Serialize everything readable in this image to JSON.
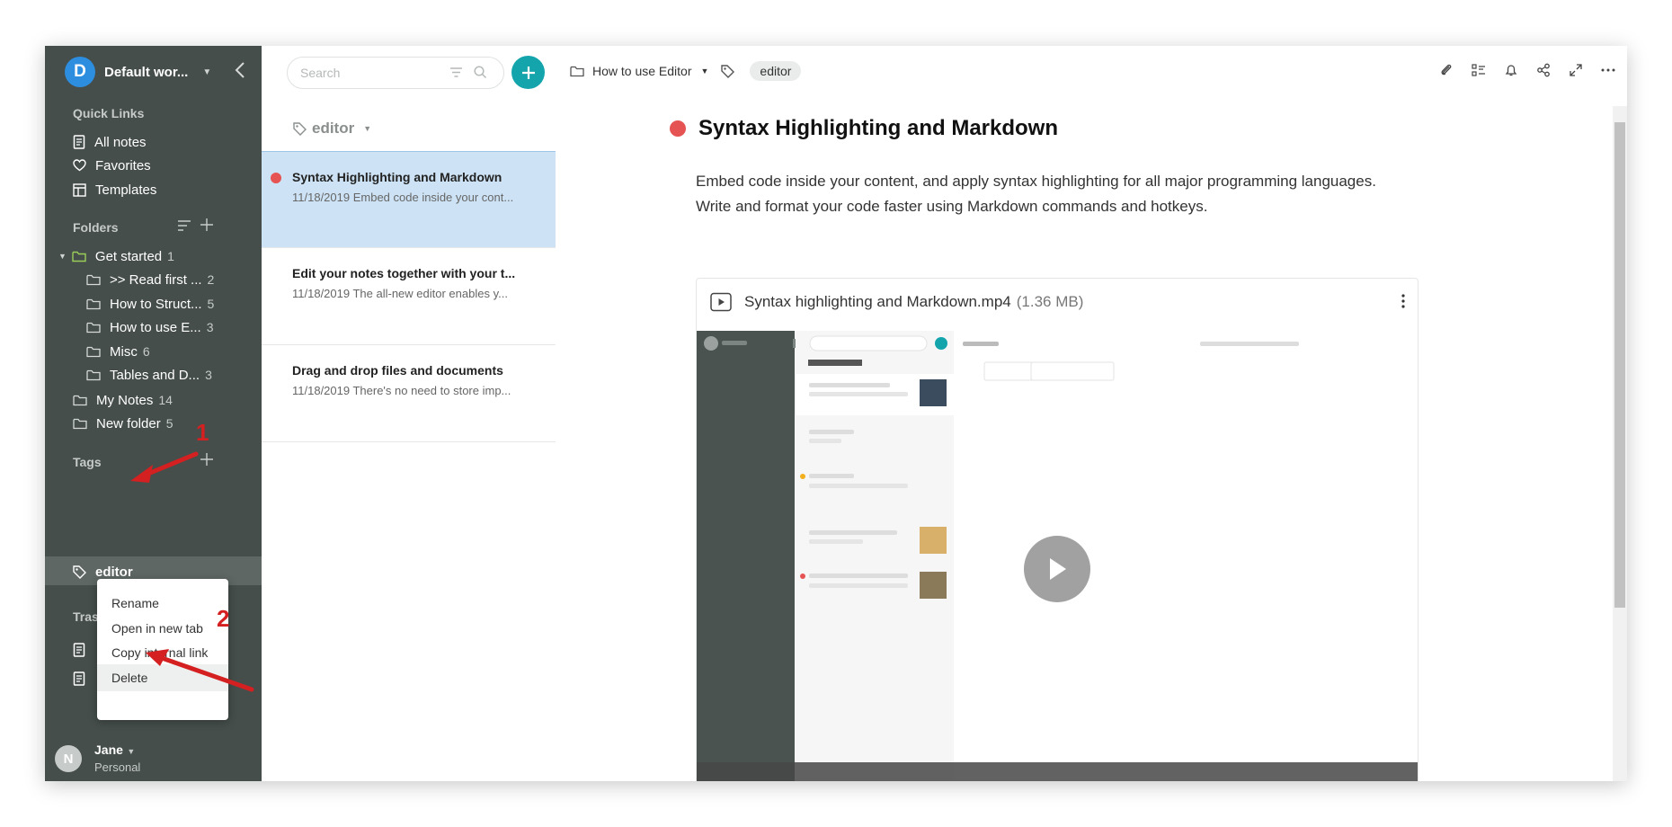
{
  "workspace": {
    "initial": "D",
    "name": "Default wor..."
  },
  "sidebar": {
    "quick_links_title": "Quick Links",
    "quick_links": [
      {
        "label": "All notes",
        "icon": "note-icon"
      },
      {
        "label": "Favorites",
        "icon": "heart-icon"
      },
      {
        "label": "Templates",
        "icon": "template-icon"
      }
    ],
    "folders_title": "Folders",
    "folders": [
      {
        "label": "Get started",
        "count": "1",
        "level": 0,
        "expanded": true
      },
      {
        "label": ">> Read first ...",
        "count": "2",
        "level": 1
      },
      {
        "label": "How to Struct...",
        "count": "5",
        "level": 1
      },
      {
        "label": "How to use E...",
        "count": "3",
        "level": 1
      },
      {
        "label": "Misc",
        "count": "6",
        "level": 1
      },
      {
        "label": "Tables and D...",
        "count": "3",
        "level": 1
      },
      {
        "label": "My Notes",
        "count": "14",
        "level": 0
      },
      {
        "label": "New folder",
        "count": "5",
        "level": 0
      }
    ],
    "tags_title": "Tags",
    "tags": [
      {
        "label": "editor"
      }
    ],
    "trash_title": "Tras"
  },
  "user": {
    "initial": "N",
    "name": "Jane",
    "plan": "Personal"
  },
  "context_menu": {
    "items": [
      "Rename",
      "Open in new tab",
      "Copy internal link",
      "Delete"
    ]
  },
  "annotations": {
    "one": "1",
    "two": "2"
  },
  "note_list": {
    "search_placeholder": "Search",
    "filter_label": "editor",
    "notes": [
      {
        "title": "Syntax Highlighting and Markdown",
        "preview": "11/18/2019 Embed code inside your cont..."
      },
      {
        "title": "Edit your notes together with your t...",
        "preview": "11/18/2019 The all-new editor enables y..."
      },
      {
        "title": "Drag and drop files and documents",
        "preview": "11/18/2019 There's no need to store imp..."
      }
    ]
  },
  "editor": {
    "breadcrumb": "How to use Editor",
    "tag": "editor",
    "title": "Syntax Highlighting and Markdown",
    "body": "Embed code inside your content, and apply syntax highlighting for all major programming languages. Write and format your code faster using Markdown commands and hotkeys.",
    "attachment": {
      "name": "Syntax highlighting and Markdown.mp4",
      "size": "(1.36 MB)"
    },
    "toolbar": [
      "attach-icon",
      "checklist-icon",
      "bell-icon",
      "share-icon",
      "expand-icon",
      "more-icon"
    ]
  },
  "colors": {
    "sidebar": "#454e4b",
    "accent": "#14a5ac",
    "selected_note": "#cde3f5",
    "note_dot": "#e55353",
    "workspace_avatar": "#2d8ee0"
  }
}
